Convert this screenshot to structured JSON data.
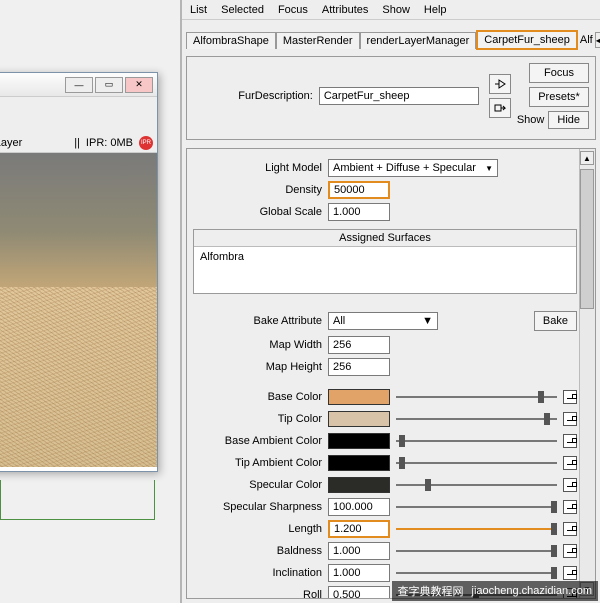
{
  "menu": [
    "List",
    "Selected",
    "Focus",
    "Attributes",
    "Show",
    "Help"
  ],
  "tabs": {
    "t0": "AlfombraShape",
    "t1": "MasterRender",
    "t2": "renderLayerManager",
    "t3": "CarpetFur_sheep",
    "after": "Alf"
  },
  "fd": {
    "label": "FurDescription:",
    "value": "CarpetFur_sheep",
    "focus": "Focus",
    "presets": "Presets*",
    "show": "Show",
    "hide": "Hide"
  },
  "render": {
    "layer": "erLayer",
    "ipr_label": "IPR: 0MB",
    "ipr_badge": "IPR"
  },
  "attrs": {
    "light_model_lbl": "Light Model",
    "light_model_val": "Ambient + Diffuse + Specular",
    "density_lbl": "Density",
    "density_val": "50000",
    "gscale_lbl": "Global Scale",
    "gscale_val": "1.000",
    "assigned_title": "Assigned Surfaces",
    "assigned_val": "Alfombra",
    "bakeattr_lbl": "Bake Attribute",
    "bakeattr_val": "All",
    "bake_btn": "Bake",
    "mapw_lbl": "Map Width",
    "mapw_val": "256",
    "maph_lbl": "Map Height",
    "maph_val": "256",
    "basec_lbl": "Base Color",
    "basec_hex": "#e2a368",
    "tipc_lbl": "Tip Color",
    "tipc_hex": "#d8c3a9",
    "baseamb_lbl": "Base Ambient Color",
    "baseamb_hex": "#000000",
    "tipamb_lbl": "Tip Ambient Color",
    "tipamb_hex": "#000000",
    "spec_lbl": "Specular Color",
    "spec_hex": "#2b2b27",
    "specsharp_lbl": "Specular Sharpness",
    "specsharp_val": "100.000",
    "length_lbl": "Length",
    "length_val": "1.200",
    "bald_lbl": "Baldness",
    "bald_val": "1.000",
    "incl_lbl": "Inclination",
    "incl_val": "1.000",
    "roll_lbl": "Roll",
    "roll_val": "0.500"
  },
  "watermark": {
    "a": "查字典教程网",
    "b": "jiaocheng.chazidian.com"
  }
}
